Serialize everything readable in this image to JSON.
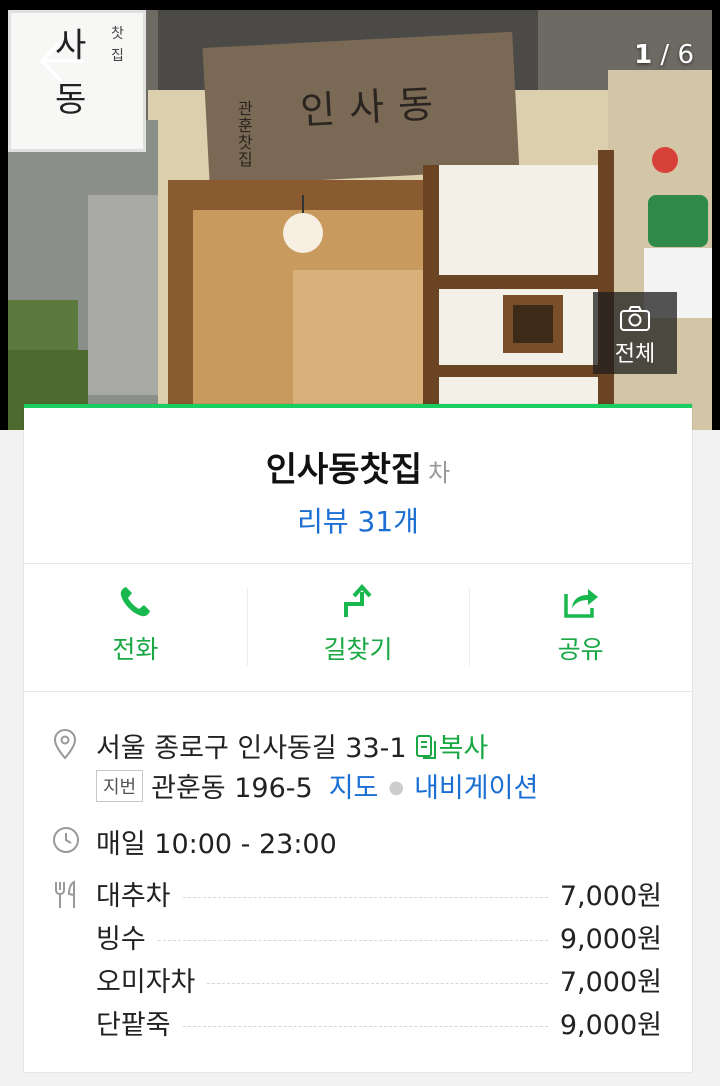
{
  "photo": {
    "counter_current": "1",
    "counter_sep": " / ",
    "counter_total": "6",
    "all_photos_label": "전체",
    "signboard_text": "인사동",
    "signboard_small": "관훈찻집",
    "sideboard_text": "사동",
    "sideboard_small": "찻집"
  },
  "place": {
    "name": "인사동찻집",
    "category": "차",
    "review_link": "리뷰 31개"
  },
  "actions": [
    {
      "label": "전화",
      "icon": "phone-icon"
    },
    {
      "label": "길찾기",
      "icon": "directions-icon"
    },
    {
      "label": "공유",
      "icon": "share-icon"
    }
  ],
  "address": {
    "road": "서울 종로구 인사동길 33-1",
    "copy_label": "복사",
    "jibun_tag": "지번",
    "jibun": "관훈동 196-5",
    "map_link": "지도",
    "nav_link": "내비게이션"
  },
  "hours": "매일 10:00 - 23:00",
  "menu": [
    {
      "name": "대추차",
      "price": "7,000원"
    },
    {
      "name": "빙수",
      "price": "9,000원"
    },
    {
      "name": "오미자차",
      "price": "7,000원"
    },
    {
      "name": "단팥죽",
      "price": "9,000원"
    }
  ],
  "colors": {
    "accent_green": "#19ce60",
    "link_blue": "#1b6fd2"
  }
}
